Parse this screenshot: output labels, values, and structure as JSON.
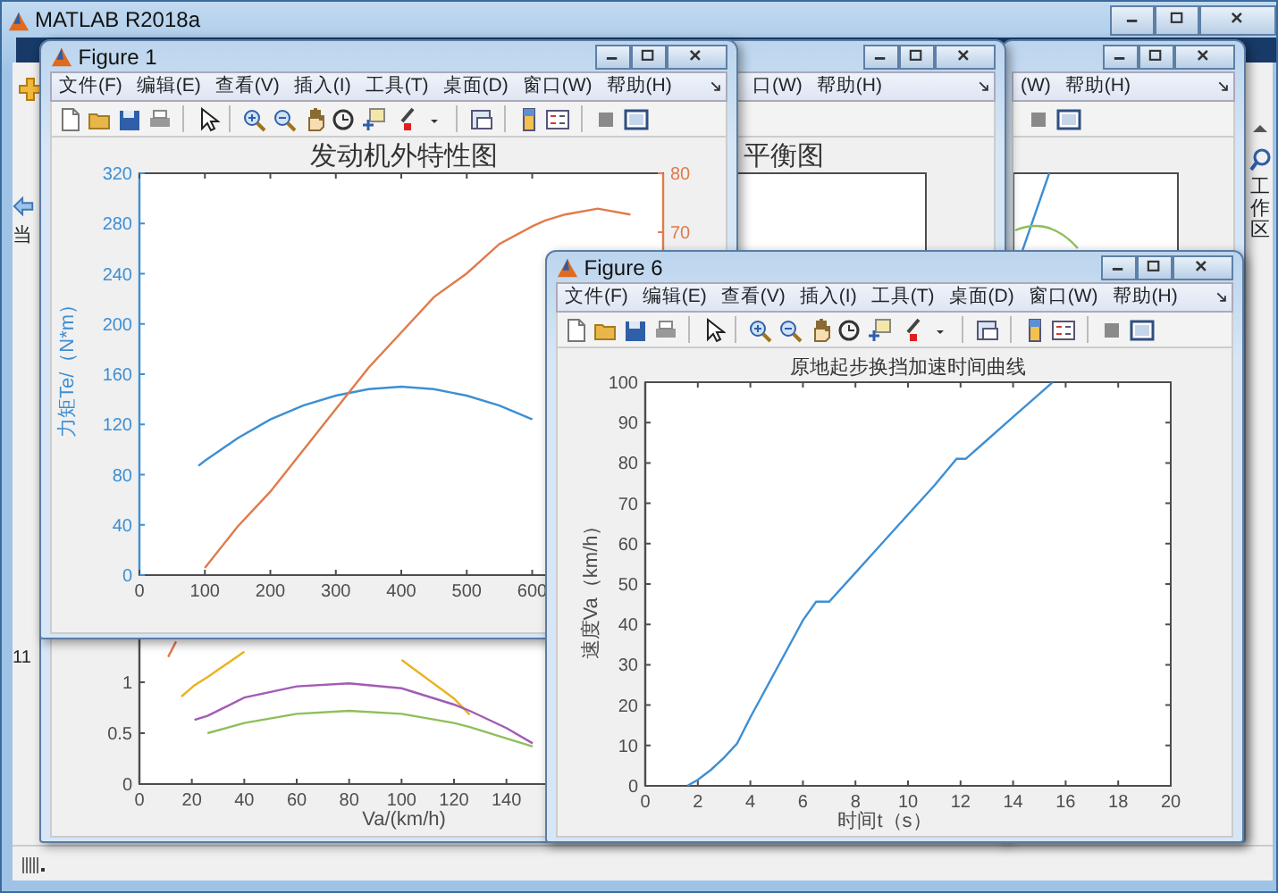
{
  "main_window": {
    "title": "MATLAB R2018a",
    "folder_label": "当",
    "command_text": "11",
    "side_panel_label": "工作区"
  },
  "back_window_right": {
    "menu": [
      "(W)",
      "帮助(H)"
    ]
  },
  "back_window_left": {
    "menu": [
      "口(W)",
      "帮助(H)"
    ],
    "chart_data": {
      "type": "line",
      "title": "平衡图",
      "xlabel": "Va/(km/h)",
      "xlim": [
        0,
        300
      ],
      "ylim": [
        0,
        6
      ],
      "xticks": [
        0,
        20,
        40,
        60,
        80,
        100,
        120,
        140
      ],
      "yticks": [
        0,
        0.5,
        1
      ],
      "x": [
        11,
        14,
        16,
        21,
        26,
        40,
        60,
        80,
        100,
        120,
        126,
        140,
        150
      ],
      "series": [
        {
          "color": "#e07a4a",
          "values": [
            1.25,
            1.4,
            null,
            null,
            null,
            null,
            null,
            null,
            null,
            null,
            null,
            null,
            null
          ]
        },
        {
          "color": "#edb120",
          "values": [
            null,
            null,
            0.86,
            0.97,
            1.05,
            1.3,
            null,
            null,
            1.22,
            0.84,
            0.68,
            null,
            null
          ]
        },
        {
          "color": "#a25bb5",
          "values": [
            null,
            null,
            null,
            0.63,
            0.67,
            0.85,
            0.96,
            0.99,
            0.94,
            0.78,
            0.72,
            0.55,
            0.4
          ]
        },
        {
          "color": "#8dbf5a",
          "values": [
            null,
            null,
            null,
            null,
            0.5,
            0.6,
            0.69,
            0.72,
            0.69,
            0.6,
            0.56,
            0.45,
            0.37
          ]
        }
      ]
    }
  },
  "figure_1": {
    "title": "Figure 1",
    "menu": [
      "文件(F)",
      "编辑(E)",
      "查看(V)",
      "插入(I)",
      "工具(T)",
      "桌面(D)",
      "窗口(W)",
      "帮助(H)"
    ],
    "chart_data": {
      "type": "line",
      "title": "发动机外特性图",
      "ylabel": "力矩Te/（N*m）",
      "xlim": [
        0,
        800
      ],
      "ylim": [
        0,
        320
      ],
      "xticks": [
        0,
        100,
        200,
        300,
        400,
        500,
        600
      ],
      "yticks": [
        0,
        40,
        80,
        120,
        160,
        200,
        240,
        280,
        320
      ],
      "y2lim": [
        11.8,
        80
      ],
      "y2ticks": [
        70,
        80
      ],
      "x": [
        90,
        100,
        150,
        200,
        250,
        300,
        350,
        400,
        450,
        500,
        550,
        600,
        620,
        650,
        700,
        750
      ],
      "series": [
        {
          "color": "#3d8fd4",
          "values": [
            87,
            91,
            109,
            124,
            135,
            143,
            148,
            150,
            148,
            143,
            135,
            124,
            null,
            null,
            null,
            null
          ]
        },
        {
          "color": "#e07a4a",
          "axis": "y2",
          "values": [
            null,
            13,
            20,
            26,
            33,
            40,
            47,
            53,
            59,
            63,
            68,
            71,
            72,
            73,
            74,
            73
          ]
        }
      ]
    }
  },
  "figure_6": {
    "title": "Figure 6",
    "menu": [
      "文件(F)",
      "编辑(E)",
      "查看(V)",
      "插入(I)",
      "工具(T)",
      "桌面(D)",
      "窗口(W)",
      "帮助(H)"
    ],
    "chart_data": {
      "type": "line",
      "title": "原地起步换挡加速时间曲线",
      "xlabel": "时间t（s）",
      "ylabel": "速度Va（km/h）",
      "xlim": [
        0,
        20
      ],
      "ylim": [
        0,
        100
      ],
      "xticks": [
        0,
        2,
        4,
        6,
        8,
        10,
        12,
        14,
        16,
        18,
        20
      ],
      "yticks": [
        0,
        10,
        20,
        30,
        40,
        50,
        60,
        70,
        80,
        90,
        100
      ],
      "x": [
        1.6,
        2,
        2.5,
        3,
        3.5,
        4,
        4.5,
        5,
        5.5,
        6,
        6.5,
        7,
        8,
        9,
        10,
        11,
        11.85,
        12.2,
        13,
        14,
        15,
        15.5
      ],
      "series": [
        {
          "color": "#3d8fd4",
          "values": [
            0,
            1.5,
            4,
            7,
            10.5,
            17,
            23,
            29,
            35,
            41,
            45.6,
            45.6,
            52.8,
            60,
            67.2,
            74.4,
            81,
            81,
            85.6,
            91.4,
            97.1,
            100
          ]
        }
      ]
    }
  }
}
